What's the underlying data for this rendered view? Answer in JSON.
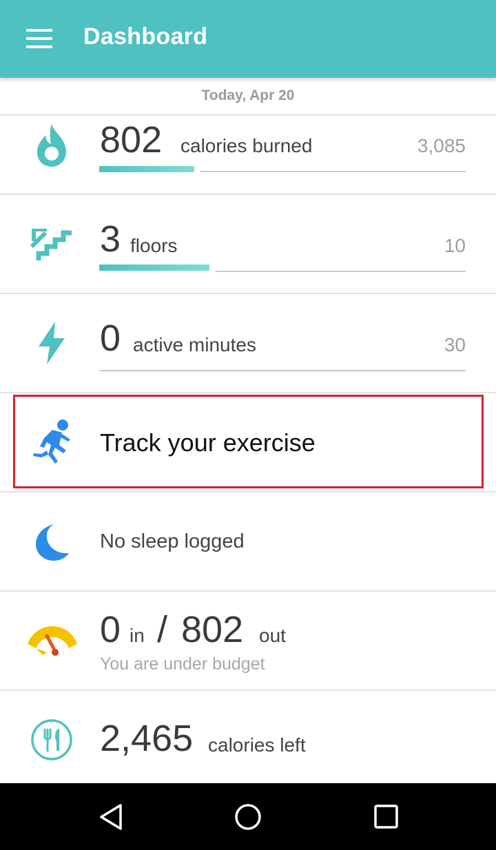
{
  "appbar": {
    "title": "Dashboard",
    "menu_icon": "hamburger-menu-icon"
  },
  "date_label": "Today, Apr 20",
  "stats": [
    {
      "key": "calories",
      "icon": "flame-icon",
      "value": "802",
      "unit": "calories burned",
      "goal": "3,085",
      "progress": 0.26
    },
    {
      "key": "floors",
      "icon": "stairs-icon",
      "value": "3",
      "unit": "floors",
      "goal": "10",
      "progress": 0.3
    },
    {
      "key": "active",
      "icon": "lightning-icon",
      "value": "0",
      "unit": "active minutes",
      "goal": "30",
      "progress": 0
    }
  ],
  "exercise": {
    "icon": "runner-icon",
    "label": "Track your exercise"
  },
  "sleep": {
    "icon": "moon-icon",
    "label": "No sleep logged"
  },
  "budget": {
    "icon": "gauge-icon",
    "in_value": "0",
    "in_label": "in",
    "separator": "/",
    "out_value": "802",
    "out_label": "out",
    "status": "You are under budget"
  },
  "food": {
    "icon": "fork-knife-icon",
    "value": "2,465",
    "label": "calories left"
  },
  "navbar": {
    "back_icon": "back-triangle-icon",
    "home_icon": "home-circle-icon",
    "recents_icon": "recents-square-icon"
  },
  "colors": {
    "appbar": "#4fc1c0",
    "accent": "#4fc1c0",
    "highlight": "#d62230",
    "sleep_blue": "#2d8ce8",
    "budget_yellow": "#f6c200"
  }
}
